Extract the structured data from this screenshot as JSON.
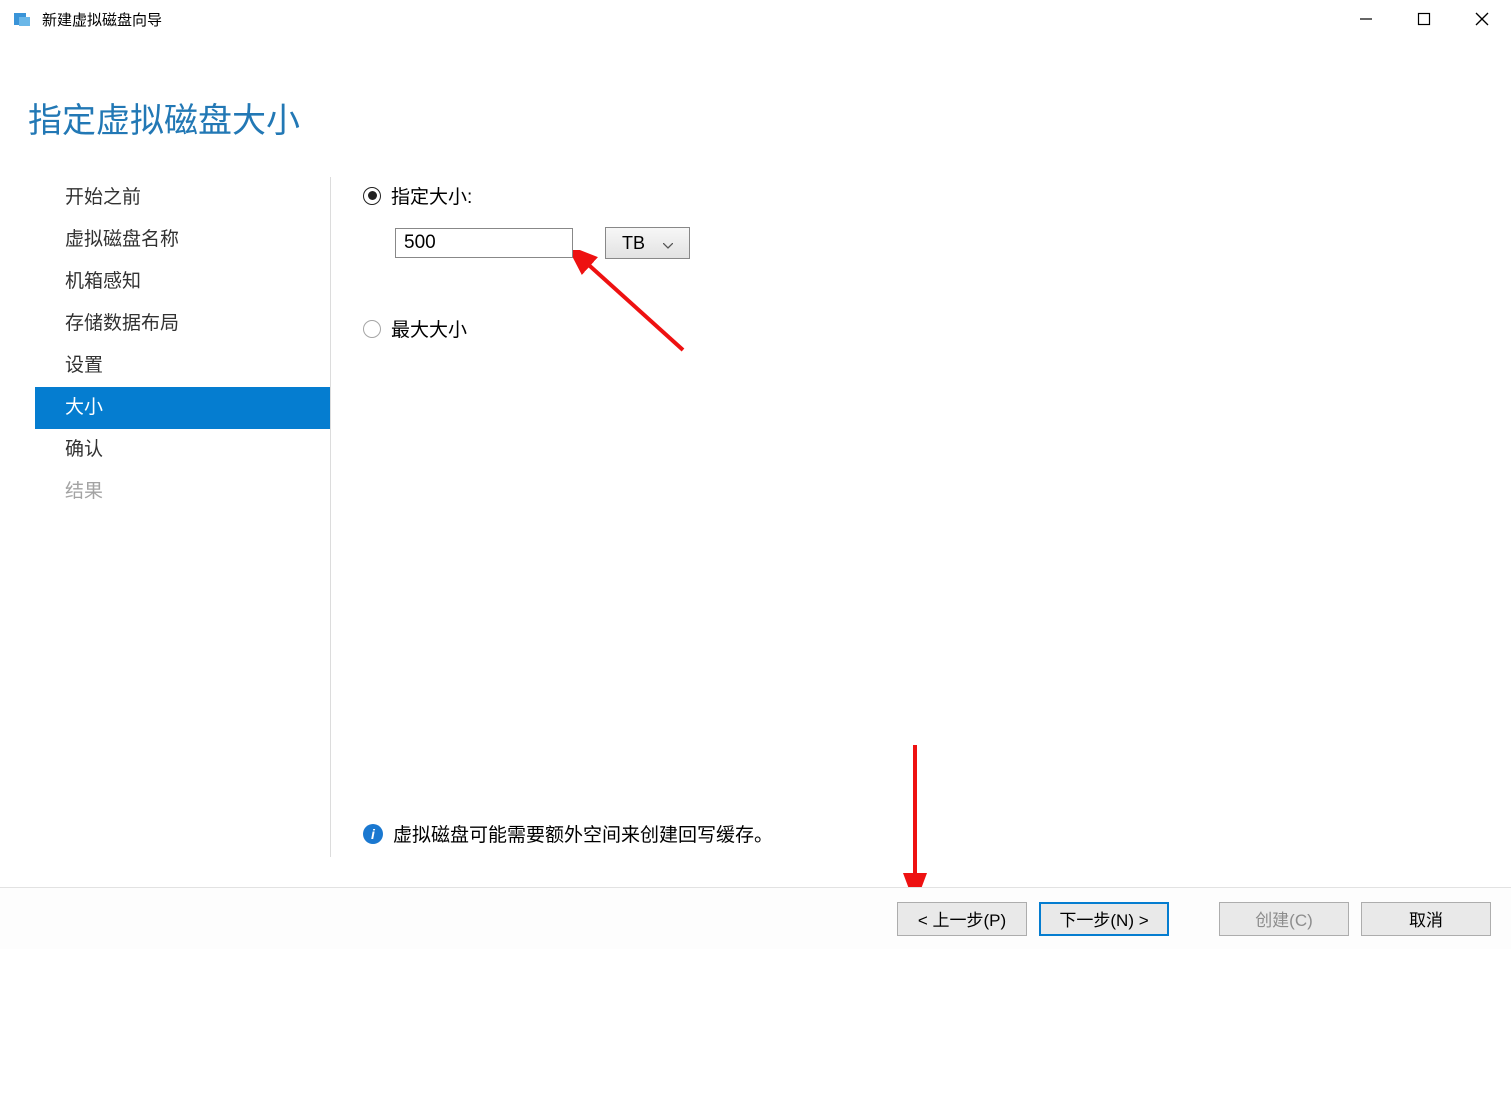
{
  "window": {
    "title": "新建虚拟磁盘向导"
  },
  "page": {
    "heading": "指定虚拟磁盘大小"
  },
  "sidebar": {
    "items": [
      {
        "label": "开始之前"
      },
      {
        "label": "虚拟磁盘名称"
      },
      {
        "label": "机箱感知"
      },
      {
        "label": "存储数据布局"
      },
      {
        "label": "设置"
      },
      {
        "label": "大小"
      },
      {
        "label": "确认"
      },
      {
        "label": "结果"
      }
    ]
  },
  "options": {
    "specify_label": "指定大小:",
    "max_label": "最大大小",
    "size_value": "500",
    "unit_selected": "TB"
  },
  "info": {
    "text": "虚拟磁盘可能需要额外空间来创建回写缓存。"
  },
  "buttons": {
    "prev": "< 上一步(P)",
    "next": "下一步(N) >",
    "create": "创建(C)",
    "cancel": "取消"
  }
}
